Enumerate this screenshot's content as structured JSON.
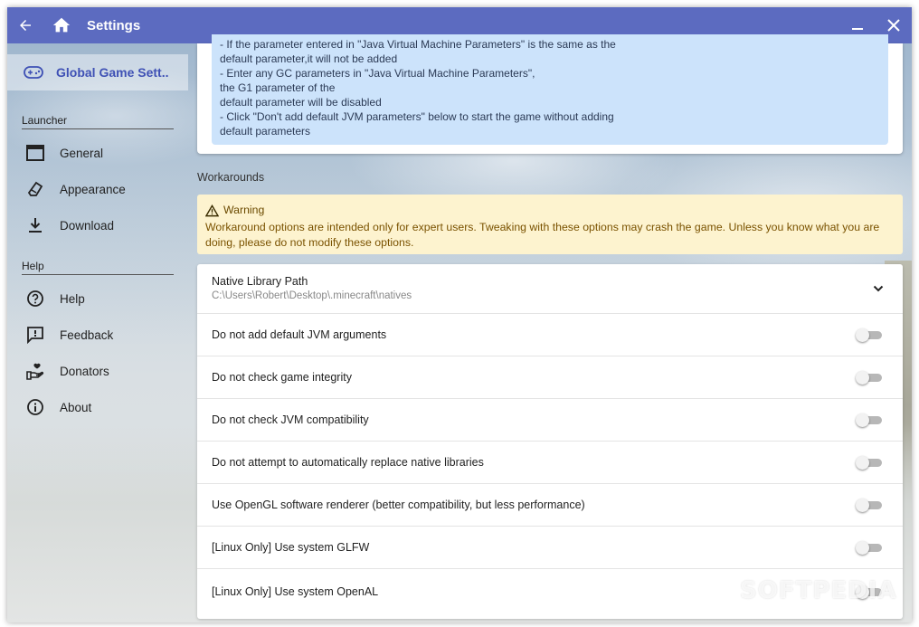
{
  "titlebar": {
    "title": "Settings",
    "back_icon": "back-arrow-icon",
    "home_icon": "home-icon",
    "minimize_icon": "minimize-icon",
    "close_icon": "close-icon"
  },
  "sidebar": {
    "active_item": {
      "label": "Global Game Sett...",
      "icon": "gamepad-icon"
    },
    "groups": [
      {
        "header": "Launcher",
        "items": [
          {
            "label": "General",
            "icon": "window-icon"
          },
          {
            "label": "Appearance",
            "icon": "brush-icon"
          },
          {
            "label": "Download",
            "icon": "download-icon"
          }
        ]
      },
      {
        "header": "Help",
        "items": [
          {
            "label": "Help",
            "icon": "help-circle-icon"
          },
          {
            "label": "Feedback",
            "icon": "feedback-icon"
          },
          {
            "label": "Donators",
            "icon": "donate-hand-icon"
          },
          {
            "label": "About",
            "icon": "info-icon"
          }
        ]
      }
    ]
  },
  "info_box": {
    "lines": [
      "- If the parameter entered in \"Java Virtual Machine Parameters\" is the same as the",
      "default parameter,it will not be added",
      "- Enter any GC parameters in \"Java Virtual Machine Parameters\",",
      "the G1 parameter of the",
      "default parameter will be disabled",
      "- Click \"Don't add default JVM parameters\" below to start the game without adding",
      "default parameters"
    ]
  },
  "workarounds": {
    "section_title": "Workarounds",
    "warning": {
      "title": "Warning",
      "text": "Workaround options are intended only for expert users. Tweaking with these options may crash the game. Unless you know what you are doing, please do not modify these options."
    },
    "native_library": {
      "label": "Native Library Path",
      "value": "C:\\Users\\Robert\\Desktop\\.minecraft\\natives"
    },
    "toggles": [
      {
        "label": "Do not add default JVM arguments",
        "enabled": false
      },
      {
        "label": "Do not check game integrity",
        "enabled": false
      },
      {
        "label": "Do not check JVM compatibility",
        "enabled": false
      },
      {
        "label": "Do not attempt to automatically replace native libraries",
        "enabled": false
      },
      {
        "label": "Use OpenGL software renderer (better compatibility, but less performance)",
        "enabled": false
      },
      {
        "label": "[Linux Only] Use system GLFW",
        "enabled": false
      },
      {
        "label": "[Linux Only] Use system OpenAL",
        "enabled": false
      }
    ]
  },
  "watermark": "SOFTPEDIA",
  "colors": {
    "titlebar": "#5c6bc0",
    "accent": "#3f51b5",
    "info_bg": "#cce3fb",
    "warning_bg": "#fdf3cf",
    "warning_text": "#7a5200"
  }
}
